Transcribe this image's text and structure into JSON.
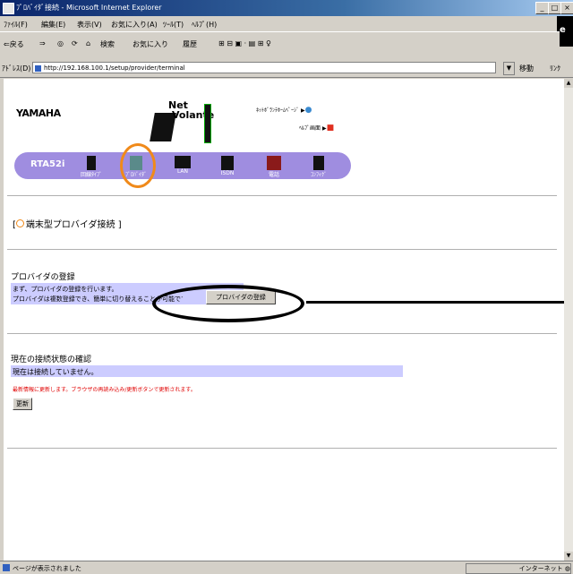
{
  "window": {
    "title": "ﾌﾟﾛﾊﾞｲﾀﾞ接続 - Microsoft Internet Explorer",
    "min": "_",
    "max": "□",
    "close": "×"
  },
  "menu": [
    "ﾌｧｲﾙ(F)",
    "編集(E)",
    "表示(V)",
    "お気に入り(A)",
    "ﾂｰﾙ(T)",
    "ﾍﾙﾌﾟ(H)"
  ],
  "toolbar": {
    "back": "⇐戻る",
    "forward": "⇒",
    "stop": "◎",
    "refresh": "⟳",
    "home": "⌂",
    "search": "検索",
    "favorites": "お気に入り",
    "history": "履歴",
    "extras": "⊞ ⊟ ▣ · ▤ ⊞ ♀"
  },
  "address": {
    "label": "ｱﾄﾞﾚｽ(D)",
    "url": "http://192.168.100.1/setup/provider/terminal",
    "dropdown": "▼",
    "go": "移動",
    "links": "ﾘﾝｸ"
  },
  "page": {
    "brand": "YAMAHA",
    "logo_top": "Net",
    "logo_bottom": "Volante",
    "link_home": "ﾈｯﾄﾎﾞﾗﾝﾃﾎｰﾑﾍﾟｰｼﾞ",
    "link_help": "ﾍﾙﾌﾟ画面",
    "model": "RTA52i",
    "nav": [
      "回線ﾀｲﾌﾟ",
      "ﾌﾟﾛﾊﾞｲﾀﾞ",
      "LAN",
      "ISDN",
      "電話",
      "ｺﾝﾌｨｸﾞ"
    ],
    "section_title": "端末型プロバイダ接続",
    "register_title": "プロバイダの登録",
    "register_line1": "まず、プロバイダの登録を行います。",
    "register_line2": "プロバイダは複数登録でき、簡単に切り替えることが可能です。",
    "register_button": "プロバイダの登録",
    "status_title": "現在の接続状態の確認",
    "status_value": "現在は接続していません。",
    "status_note": "最新情報に更新します。ブラウザの再読み込み/更新ボタンで更新されます。",
    "update_button": "更新"
  },
  "statusbar": {
    "text": "ページが表示されました",
    "zone": "インターネット"
  }
}
